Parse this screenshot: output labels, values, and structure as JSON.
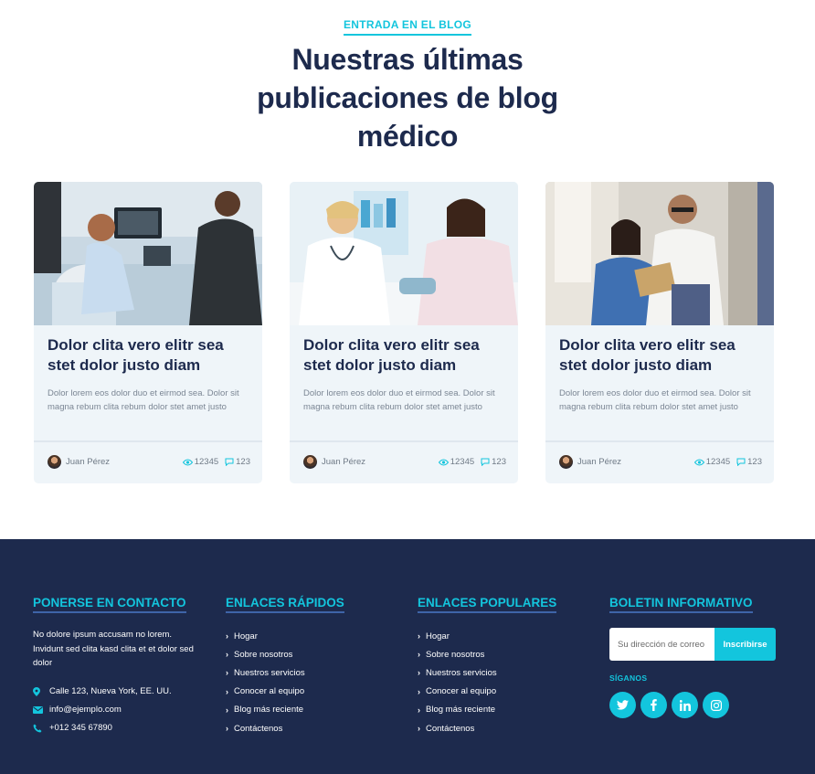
{
  "blog": {
    "eyebrow": "ENTRADA EN EL BLOG",
    "title": "Nuestras últimas publicaciones de blog médico",
    "posts": [
      {
        "title": "Dolor clita vero elitr sea stet dolor justo diam",
        "excerpt": "Dolor lorem eos dolor duo et eirmod sea. Dolor sit magna rebum clita rebum dolor stet amet justo",
        "author": "Juan Pérez",
        "views": "12345",
        "comments": "123"
      },
      {
        "title": "Dolor clita vero elitr sea stet dolor justo diam",
        "excerpt": "Dolor lorem eos dolor duo et eirmod sea. Dolor sit magna rebum clita rebum dolor stet amet justo",
        "author": "Juan Pérez",
        "views": "12345",
        "comments": "123"
      },
      {
        "title": "Dolor clita vero elitr sea stet dolor justo diam",
        "excerpt": "Dolor lorem eos dolor duo et eirmod sea. Dolor sit magna rebum clita rebum dolor stet amet justo",
        "author": "Juan Pérez",
        "views": "12345",
        "comments": "123"
      }
    ]
  },
  "footer": {
    "contact": {
      "heading": "PONERSE EN CONTACTO",
      "text": "No dolore ipsum accusam no lorem. Invidunt sed clita kasd clita et et dolor sed dolor",
      "address": "Calle 123, Nueva York, EE. UU.",
      "email": "info@ejemplo.com",
      "phone": "+012 345 67890"
    },
    "quick_links": {
      "heading": "ENLACES RÁPIDOS",
      "items": [
        "Hogar",
        "Sobre nosotros",
        "Nuestros servicios",
        "Conocer al equipo",
        "Blog más reciente",
        "Contáctenos"
      ]
    },
    "popular_links": {
      "heading": "ENLACES POPULARES",
      "items": [
        "Hogar",
        "Sobre nosotros",
        "Nuestros servicios",
        "Conocer al equipo",
        "Blog más reciente",
        "Contáctenos"
      ]
    },
    "newsletter": {
      "heading": "BOLETIN INFORMATIVO",
      "placeholder": "Su dirección de correo",
      "button": "Inscribirse",
      "follow": "SÍGANOS"
    }
  },
  "colors": {
    "accent": "#13c5dd",
    "navy": "#1d2a4d",
    "card_bg": "#eff5f9"
  },
  "icons": {
    "views": "eye-icon",
    "comments": "comment-icon",
    "address": "map-marker-icon",
    "email": "envelope-icon",
    "phone": "phone-icon",
    "social": [
      "twitter-icon",
      "facebook-icon",
      "linkedin-icon",
      "instagram-icon"
    ]
  }
}
